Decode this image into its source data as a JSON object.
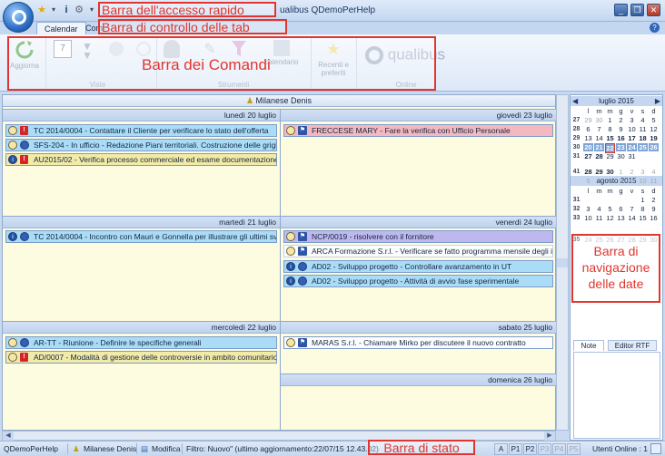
{
  "window": {
    "title": "Qualibus - QDemoPerHelp",
    "title_partial": "ualibus     QDemoPerHelp"
  },
  "tabs": [
    "Calendar",
    "Com"
  ],
  "ribbon": {
    "buttons": {
      "aggiorna": "Aggiorna",
      "day_count": "7",
      "calendario": "calendario",
      "recenti": "Recenti e preferiti",
      "logo": "qualibus"
    },
    "groups": {
      "viste": "Viste",
      "strumenti": "Strumenti",
      "online": "Online"
    }
  },
  "annotations": {
    "quick_access": "Barra dell'accesso rapido",
    "tab_control": "Barra di controllo delle tab",
    "commands": "Barra dei Comandi",
    "date_nav": "Barra di navigazione delle date",
    "status": "Barra di stato"
  },
  "resource_name": "Milanese Denis",
  "days": {
    "lunedi": {
      "header": "lunedì 20 luglio",
      "items": [
        "TC 2014/0004 - Contattare il Cliente per verificare lo stato dell'offerta",
        "SFS-204 - In ufficio - Redazione Piani territoriali. Costruzione delle griglie di valut",
        "AU2015/02 - Verifica processo commerciale ed esame documentazione Gara"
      ]
    },
    "giovedi": {
      "header": "giovedì 23 luglio",
      "items": [
        "FRECCESE MARY - Fare la verifica con Ufficio Personale"
      ]
    },
    "martedi": {
      "header": "martedì 21 luglio",
      "items": [
        "TC 2014/0004 - Incontro con Mauri e Gonnella per illustrare gli ultimi sviluppi"
      ]
    },
    "venerdi": {
      "header": "venerdì 24 luglio",
      "items": [
        "NCP/0019 - risolvere con il fornitore",
        "ARCA Formazione S.r.l. - Verificare se fatto programma mensile degli interventi",
        "AD02 - Sviluppo progetto - Controllare avanzamento in UT",
        "AD02 - Sviluppo progetto - Attività di avvio fase sperimentale"
      ]
    },
    "mercoledi": {
      "header": "mercoledì 22 luglio",
      "items": [
        "AR-TT - Riunione - Definire le specifiche generali",
        "AD/0007 - Modalità di gestione delle controversie in ambito comunitario"
      ]
    },
    "sabato": {
      "header": "sabato 25 luglio",
      "items": [
        "MARAS S.r.l. - Chiamare Mirko per discutere il nuovo contratto"
      ]
    },
    "domenica": {
      "header": "domenica 26 luglio",
      "items": []
    }
  },
  "calendar": {
    "nav_prev": "◀",
    "nav_next": "▶",
    "weekday_headers": [
      "l",
      "m",
      "m",
      "g",
      "v",
      "s",
      "d"
    ],
    "july": {
      "title": "luglio 2015",
      "weeks": [
        [
          "27",
          "29",
          "30",
          "1",
          "2",
          "3",
          "4",
          "5"
        ],
        [
          "28",
          "6",
          "7",
          "8",
          "9",
          "10",
          "11",
          "12"
        ],
        [
          "29",
          "13",
          "14",
          "15",
          "16",
          "17",
          "18",
          "19"
        ],
        [
          "30",
          "20",
          "21",
          "22",
          "23",
          "24",
          "25",
          "26"
        ],
        [
          "31",
          "27",
          "28",
          "29",
          "30",
          "31",
          "",
          ""
        ]
      ]
    },
    "august": {
      "title": "agosto 2015",
      "weeks": [
        [
          "31",
          "",
          "",
          "",
          "",
          "",
          "1",
          "2"
        ],
        [
          "32",
          "3",
          "4",
          "5",
          "6",
          "7",
          "8",
          "9"
        ],
        [
          "33",
          "10",
          "11",
          "12",
          "13",
          "14",
          "15",
          "16"
        ]
      ]
    },
    "september_fragment": {
      "row1": [
        "35",
        "24",
        "25",
        "26",
        "27",
        "28",
        "29",
        "30"
      ],
      "row_last": [
        "41",
        "28",
        "29",
        "30",
        "1",
        "2",
        "3",
        "4"
      ],
      "row_end": [
        "",
        "5",
        "6",
        "7",
        "8",
        "9",
        "10",
        "11"
      ]
    }
  },
  "notes": {
    "tab_note": "Note",
    "tab_rtf": "Editor RTF"
  },
  "statusbar": {
    "db": "QDemoPerHelp",
    "user": "Milanese Denis",
    "mode": "Modifica",
    "filter": "Filtro: Nuovo\" (ultimo aggiornamento:22/07/15 12.43.02)",
    "priorities": [
      "A",
      "P1",
      "P2",
      "P3",
      "P4",
      "P5"
    ],
    "online": "Utenti Online : 1"
  },
  "colors": {
    "appt_blue": "#aadcf7",
    "appt_yellow": "#f2eba8",
    "appt_red": "#f4b9c0",
    "appt_purple": "#bfb8ee",
    "annotation_red": "#e0362f"
  }
}
